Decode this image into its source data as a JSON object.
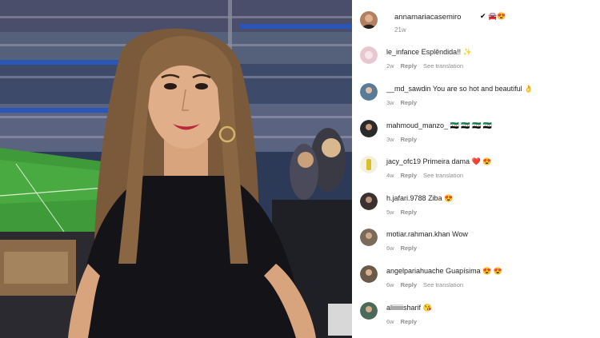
{
  "post": {
    "author": "annamariacasemiro",
    "author_badges": "✔ 🚘😍",
    "time": "21w"
  },
  "comments": [
    {
      "user": "le_infance",
      "text": "Esplêndida!! ✨",
      "time": "2w",
      "reply": "Reply",
      "translation": "See translation",
      "avatar_color": "#e8c8d0"
    },
    {
      "user": "__md_sawdin",
      "text": "You are so hot and beautiful 👌",
      "time": "3w",
      "reply": "Reply",
      "translation": "",
      "avatar_color": "#5a7a9a"
    },
    {
      "user": "mahmoud_manzo_",
      "text": "🇸🇾 🇸🇾 🇸🇾 🇸🇾",
      "time": "3w",
      "reply": "Reply",
      "translation": "",
      "avatar_color": "#2a2a2a"
    },
    {
      "user": "jacy_ofc19",
      "text": "Primeira dama ❤️ 😍",
      "time": "4w",
      "reply": "Reply",
      "translation": "See translation",
      "avatar_color": "#d8c028"
    },
    {
      "user": "h.jafari.9788",
      "text": "Ziba 😍",
      "time": "5w",
      "reply": "Reply",
      "translation": "",
      "avatar_color": "#3a3030"
    },
    {
      "user": "motiar.rahman.khan",
      "text": "Wow",
      "time": "6w",
      "reply": "Reply",
      "translation": "",
      "avatar_color": "#7a6a5a"
    },
    {
      "user": "angelpariahuache",
      "text": "Guapísima 😍 😍",
      "time": "6w",
      "reply": "Reply",
      "translation": "See translation",
      "avatar_color": "#6a5a4a"
    },
    {
      "user": "aliiiiiiisharif",
      "text": "😘",
      "time": "6w",
      "reply": "Reply",
      "translation": "",
      "avatar_color": "#4a6a5a"
    }
  ]
}
